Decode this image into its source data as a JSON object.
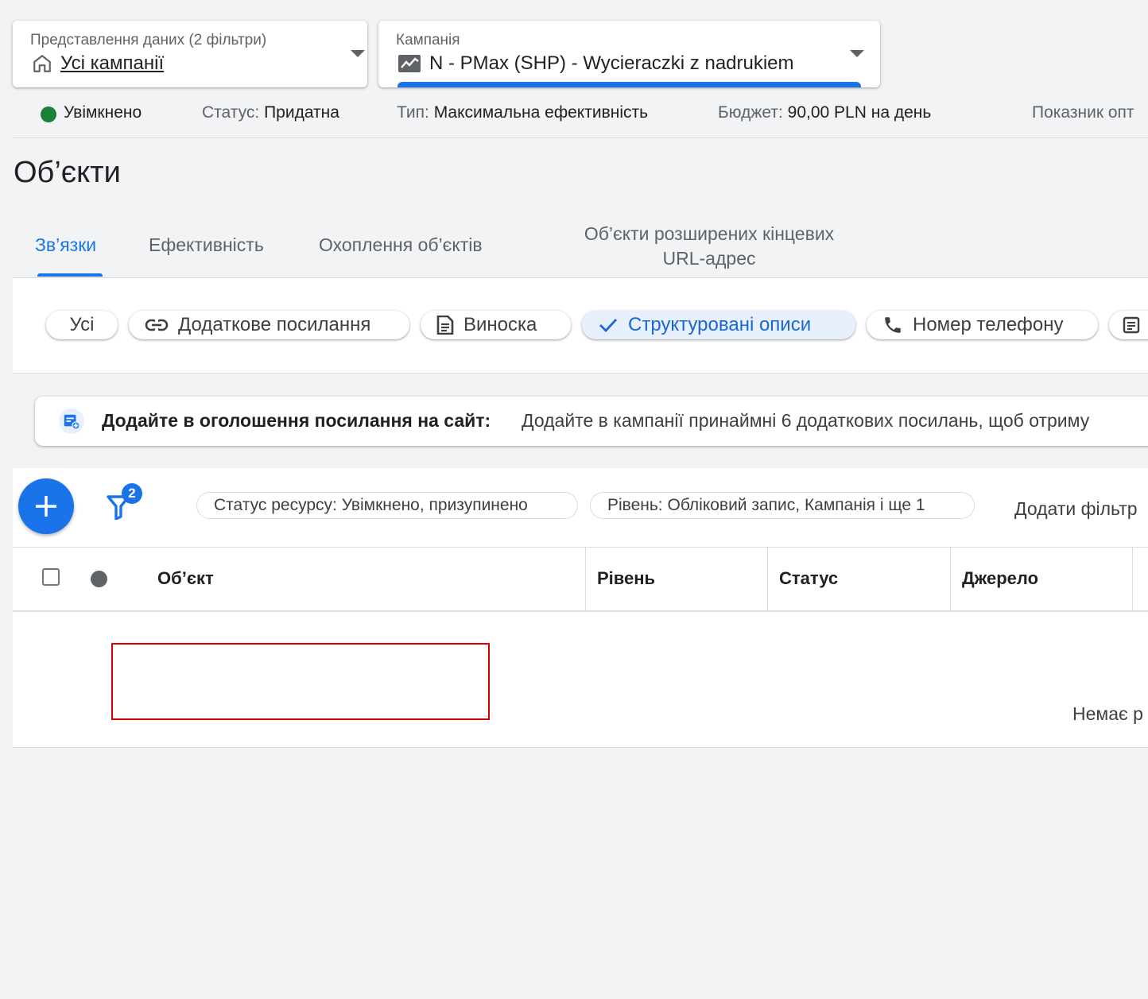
{
  "view_selector": {
    "label": "Представлення даних (2 фільтри)",
    "value": "Усі кампанії"
  },
  "campaign_selector": {
    "label": "Кампанія",
    "value": "N - PMax (SHP) - Wycieraczki z nadrukiem"
  },
  "status_bar": {
    "enabled": "Увімкнено",
    "status_key": "Статус:",
    "status_value": "Придатна",
    "type_key": "Тип:",
    "type_value": "Максимальна ефективність",
    "budget_key": "Бюджет:",
    "budget_value": "90,00 PLN на день",
    "score_key": "Показник опт"
  },
  "page_title": "Об’єкти",
  "tabs": [
    {
      "label": "Зв’язки"
    },
    {
      "label": "Ефективність"
    },
    {
      "label": "Охоплення об’єктів"
    },
    {
      "label": "Об’єкти розширених кінцевих URL-адрес"
    }
  ],
  "asset_chips": [
    {
      "label": "Усі"
    },
    {
      "label": "Додаткове посилання"
    },
    {
      "label": "Виноска"
    },
    {
      "label": "Структуровані описи"
    },
    {
      "label": "Номер телефону"
    }
  ],
  "banner": {
    "title": "Додайте в оголошення посилання на сайт:",
    "text": "Додайте в кампанії принаймні 6 додаткових посилань, щоб отриму"
  },
  "toolbar": {
    "filter_count": "2",
    "filters": [
      {
        "label": "Статус ресурсу: Увімкнено, призупинено"
      },
      {
        "label": "Рівень: Обліковий запис, Кампанія і ще 1"
      }
    ],
    "add_filter": "Додати фільтр"
  },
  "table": {
    "columns": [
      "Об’єкт",
      "Рівень",
      "Статус",
      "Джерело"
    ],
    "empty_message": "Немає р"
  },
  "colors": {
    "accent": "#1a73e8",
    "enabled": "#188038",
    "highlight_box": "#d50000"
  }
}
